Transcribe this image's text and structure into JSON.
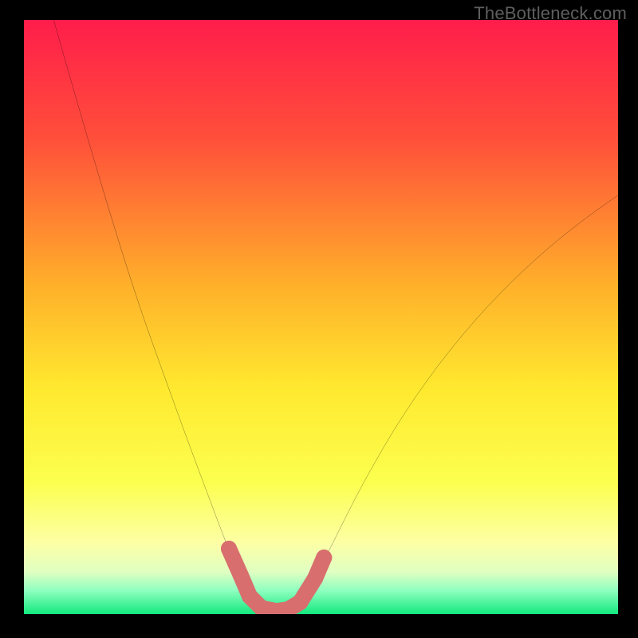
{
  "watermark": "TheBottleneck.com",
  "chart_data": {
    "type": "line",
    "title": "",
    "xlabel": "",
    "ylabel": "",
    "xlim": [
      0,
      100
    ],
    "ylim": [
      0,
      100
    ],
    "grid": false,
    "legend": false,
    "background_gradient": {
      "stops": [
        {
          "pct": 0,
          "color": "#ff1d4b"
        },
        {
          "pct": 20,
          "color": "#ff4f3a"
        },
        {
          "pct": 45,
          "color": "#ffb12a"
        },
        {
          "pct": 62,
          "color": "#ffe92f"
        },
        {
          "pct": 78,
          "color": "#fcff4f"
        },
        {
          "pct": 88,
          "color": "#fdffa5"
        },
        {
          "pct": 93,
          "color": "#dfffc2"
        },
        {
          "pct": 96,
          "color": "#8fffc0"
        },
        {
          "pct": 100,
          "color": "#13e97e"
        }
      ]
    },
    "series": [
      {
        "name": "bottleneck-curve",
        "stroke": "#000000",
        "points": [
          {
            "x": 5.0,
            "y": 100.0
          },
          {
            "x": 9.0,
            "y": 86.0
          },
          {
            "x": 14.0,
            "y": 69.0
          },
          {
            "x": 19.0,
            "y": 53.0
          },
          {
            "x": 24.0,
            "y": 39.0
          },
          {
            "x": 28.0,
            "y": 28.0
          },
          {
            "x": 31.0,
            "y": 20.0
          },
          {
            "x": 34.0,
            "y": 12.0
          },
          {
            "x": 36.5,
            "y": 6.0
          },
          {
            "x": 38.5,
            "y": 2.0
          },
          {
            "x": 41.0,
            "y": 0.5
          },
          {
            "x": 44.0,
            "y": 0.5
          },
          {
            "x": 46.0,
            "y": 1.5
          },
          {
            "x": 48.5,
            "y": 5.0
          },
          {
            "x": 52.0,
            "y": 12.0
          },
          {
            "x": 57.0,
            "y": 22.0
          },
          {
            "x": 64.0,
            "y": 34.0
          },
          {
            "x": 72.0,
            "y": 45.0
          },
          {
            "x": 80.0,
            "y": 54.0
          },
          {
            "x": 88.0,
            "y": 61.5
          },
          {
            "x": 95.0,
            "y": 67.0
          },
          {
            "x": 100.0,
            "y": 70.5
          }
        ]
      },
      {
        "name": "highlight-dots",
        "stroke": "#d86e6e",
        "shape": "round-marker",
        "points": [
          {
            "x": 34.5,
            "y": 11.0
          },
          {
            "x": 36.5,
            "y": 6.5
          },
          {
            "x": 38.0,
            "y": 3.0
          },
          {
            "x": 40.0,
            "y": 1.0
          },
          {
            "x": 42.5,
            "y": 0.5
          },
          {
            "x": 44.5,
            "y": 0.8
          },
          {
            "x": 46.5,
            "y": 2.0
          },
          {
            "x": 49.0,
            "y": 6.0
          },
          {
            "x": 50.5,
            "y": 9.5
          }
        ]
      }
    ]
  }
}
